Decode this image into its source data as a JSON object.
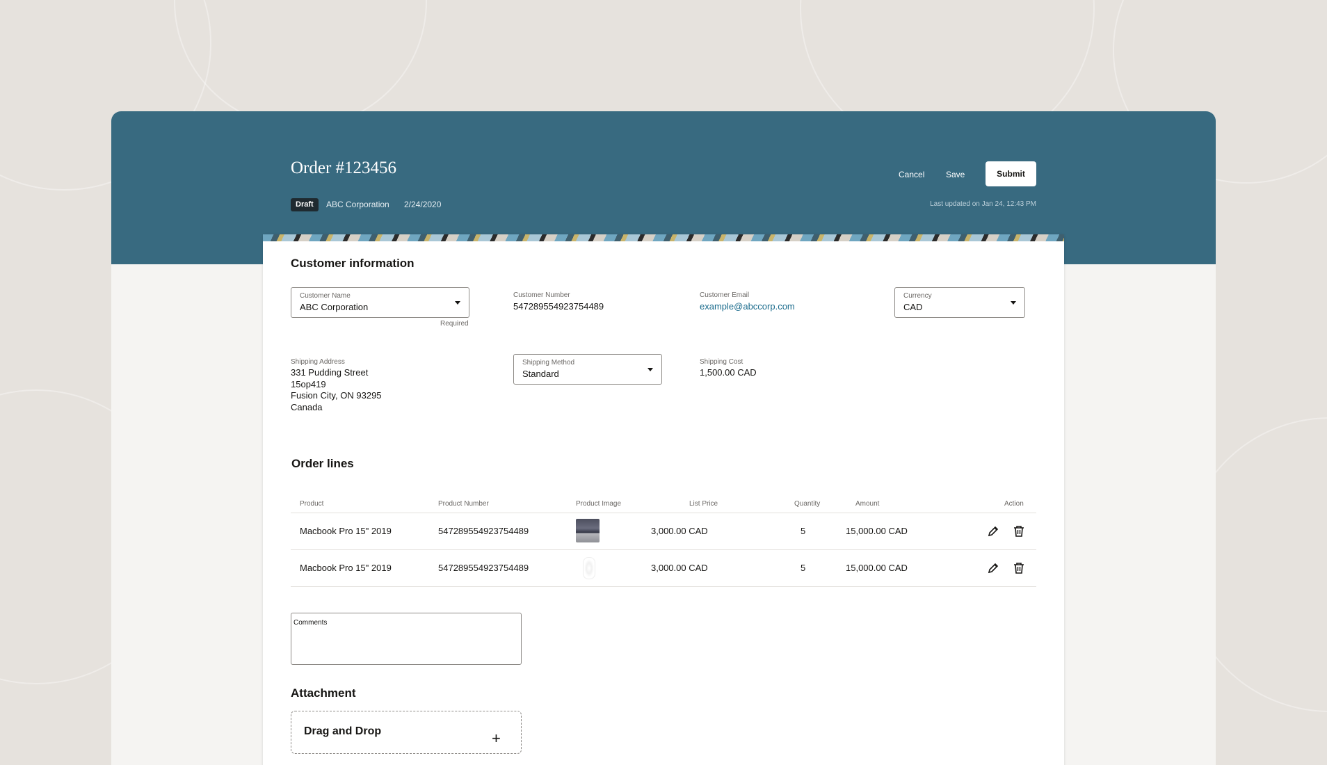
{
  "header": {
    "title": "Order #123456",
    "status_badge": "Draft",
    "customer": "ABC Corporation",
    "date": "2/24/2020",
    "cancel_label": "Cancel",
    "save_label": "Save",
    "submit_label": "Submit",
    "last_updated": "Last updated on Jan 24, 12:43 PM"
  },
  "customer_info": {
    "title": "Customer information",
    "customer_name": {
      "label": "Customer Name",
      "value": "ABC Corporation",
      "helper": "Required"
    },
    "customer_number": {
      "label": "Customer Number",
      "value": "547289554923754489"
    },
    "customer_email": {
      "label": "Customer Email",
      "value": "example@abccorp.com"
    },
    "currency": {
      "label": "Currency",
      "value": "CAD"
    },
    "shipping_address": {
      "label": "Shipping Address",
      "lines": [
        "331 Pudding Street",
        "15op419",
        "Fusion City, ON 93295",
        "Canada"
      ]
    },
    "shipping_method": {
      "label": "Shipping Method",
      "value": "Standard"
    },
    "shipping_cost": {
      "label": "Shipping Cost",
      "value": "1,500.00 CAD"
    }
  },
  "order_lines": {
    "title": "Order lines",
    "columns": [
      "Product",
      "Product Number",
      "Product Image",
      "List Price",
      "Quantity",
      "Amount",
      "Action"
    ],
    "rows": [
      {
        "product": "Macbook Pro 15\" 2019",
        "product_number": "547289554923754489",
        "image": "laptop-image",
        "list_price": "3,000.00 CAD",
        "quantity": "5",
        "amount": "15,000.00 CAD"
      },
      {
        "product": "Macbook Pro 15\" 2019",
        "product_number": "547289554923754489",
        "image": "mouse-image",
        "list_price": "3,000.00 CAD",
        "quantity": "5",
        "amount": "15,000.00 CAD"
      }
    ]
  },
  "comments": {
    "label": "Comments",
    "value": ""
  },
  "attachment": {
    "title": "Attachment",
    "dropzone_label": "Drag and Drop"
  },
  "colors": {
    "header": "#386a80",
    "link": "#1a6b8c",
    "background": "#e6e2dd"
  },
  "icons": {
    "edit": "pencil-icon",
    "delete": "trash-icon",
    "add": "plus-icon",
    "dropdown": "caret-down-icon"
  }
}
